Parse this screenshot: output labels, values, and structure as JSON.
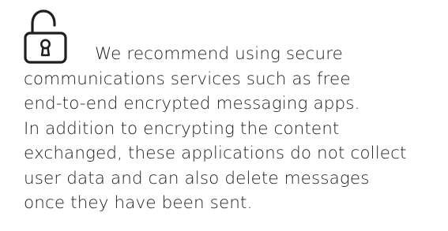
{
  "notice": {
    "icon": "unlocked-padlock-icon",
    "lines": [
      "We recommend using secure",
      "communications services such as free",
      "end-to-end encrypted messaging apps.",
      "In addition to encrypting the content",
      "exchanged, these applications do not collect",
      "user data and can also delete messages",
      "once they have been sent."
    ]
  },
  "colors": {
    "text": "#1f1f1f",
    "icon_stroke": "#1f1f1f",
    "background": "#ffffff"
  }
}
